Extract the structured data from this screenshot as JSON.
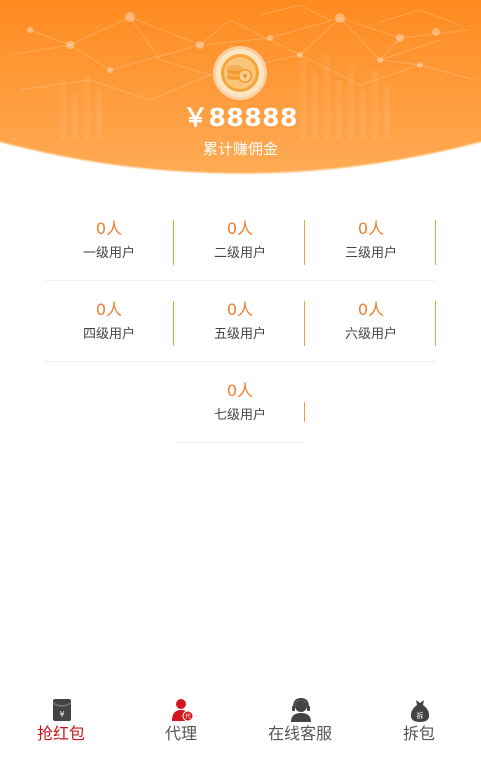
{
  "header": {
    "amount": "￥88888",
    "amount_label": "累计赚佣金"
  },
  "levels": [
    {
      "count": "0人",
      "label": "一级用户"
    },
    {
      "count": "0人",
      "label": "二级用户"
    },
    {
      "count": "0人",
      "label": "三级用户"
    },
    {
      "count": "0人",
      "label": "四级用户"
    },
    {
      "count": "0人",
      "label": "五级用户"
    },
    {
      "count": "0人",
      "label": "六级用户"
    },
    {
      "count": "0人",
      "label": "七级用户"
    }
  ],
  "tabbar": {
    "tabs": [
      {
        "label": "抢红包",
        "icon": "red-envelope-icon",
        "active": true
      },
      {
        "label": "代理",
        "icon": "agent-user-icon",
        "active": false
      },
      {
        "label": "在线客服",
        "icon": "customer-service-icon",
        "active": false
      },
      {
        "label": "拆包",
        "icon": "money-bag-icon",
        "active": false
      }
    ]
  },
  "colors": {
    "header_gradient_top": "#ff8a1f",
    "header_gradient_bottom": "#ffa64a",
    "count_text": "#f07d2c",
    "divider": "#f0a040",
    "active_tab": "#c8161d",
    "inactive_tab": "#555555"
  }
}
